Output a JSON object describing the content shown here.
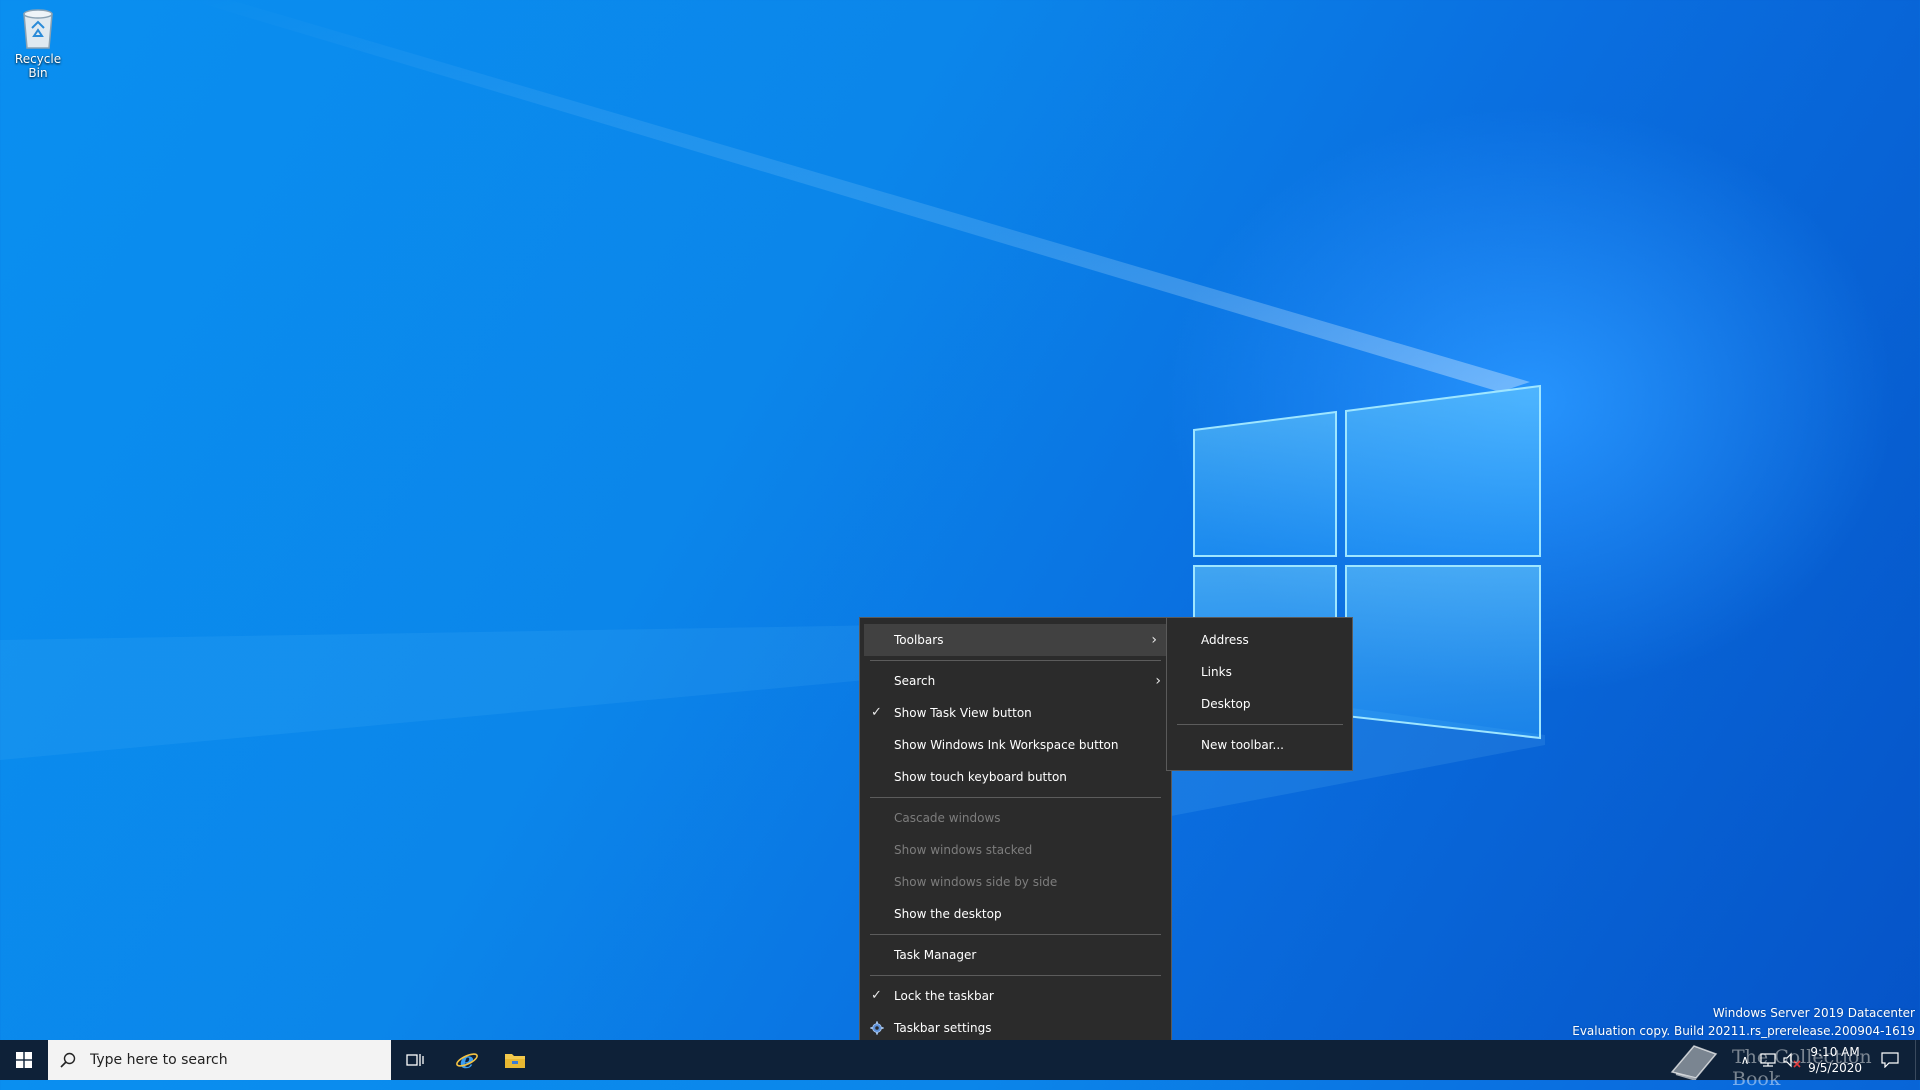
{
  "desktop": {
    "icons": [
      {
        "label": "Recycle Bin",
        "icon": "recycle-bin-icon"
      }
    ]
  },
  "context_menu": {
    "items": [
      {
        "label": "Toolbars",
        "submenu": true,
        "active": true
      },
      {
        "label": "Search",
        "submenu": true
      },
      {
        "label": "Show Task View button",
        "checked": true
      },
      {
        "label": "Show Windows Ink Workspace button"
      },
      {
        "label": "Show touch keyboard button"
      },
      {
        "label": "Cascade windows",
        "disabled": true
      },
      {
        "label": "Show windows stacked",
        "disabled": true
      },
      {
        "label": "Show windows side by side",
        "disabled": true
      },
      {
        "label": "Show the desktop"
      },
      {
        "label": "Task Manager"
      },
      {
        "label": "Lock the taskbar",
        "checked": true
      },
      {
        "label": "Taskbar settings",
        "icon": "gear-icon"
      }
    ]
  },
  "toolbars_submenu": {
    "items": [
      {
        "label": "Address"
      },
      {
        "label": "Links"
      },
      {
        "label": "Desktop"
      },
      {
        "label": "New toolbar..."
      }
    ]
  },
  "system_info": {
    "edition": "Windows Server 2019 Datacenter",
    "build": "Evaluation copy. Build 20211.rs_prerelease.200904-1619"
  },
  "taskbar": {
    "start_icon": "windows-start-icon",
    "search_placeholder": "Type here to search",
    "pinned": [
      {
        "name": "task-view",
        "icon": "task-view-icon"
      },
      {
        "name": "internet-explorer",
        "icon": "internet-explorer-icon"
      },
      {
        "name": "file-explorer",
        "icon": "file-explorer-icon"
      }
    ],
    "tray_icons": [
      "chevron-up-icon",
      "network-icon",
      "volume-muted-icon"
    ],
    "time": "9:10 AM",
    "date": "9/5/2020",
    "notification_icon": "action-center-icon"
  },
  "watermark": {
    "text": "The Collection Book"
  },
  "colors": {
    "desktop_blue": "#0a8ff0",
    "menu_bg": "#2b2b2b",
    "menu_hover": "#414141",
    "taskbar": "#0e2138",
    "disabled_text": "#7d7d7d"
  }
}
